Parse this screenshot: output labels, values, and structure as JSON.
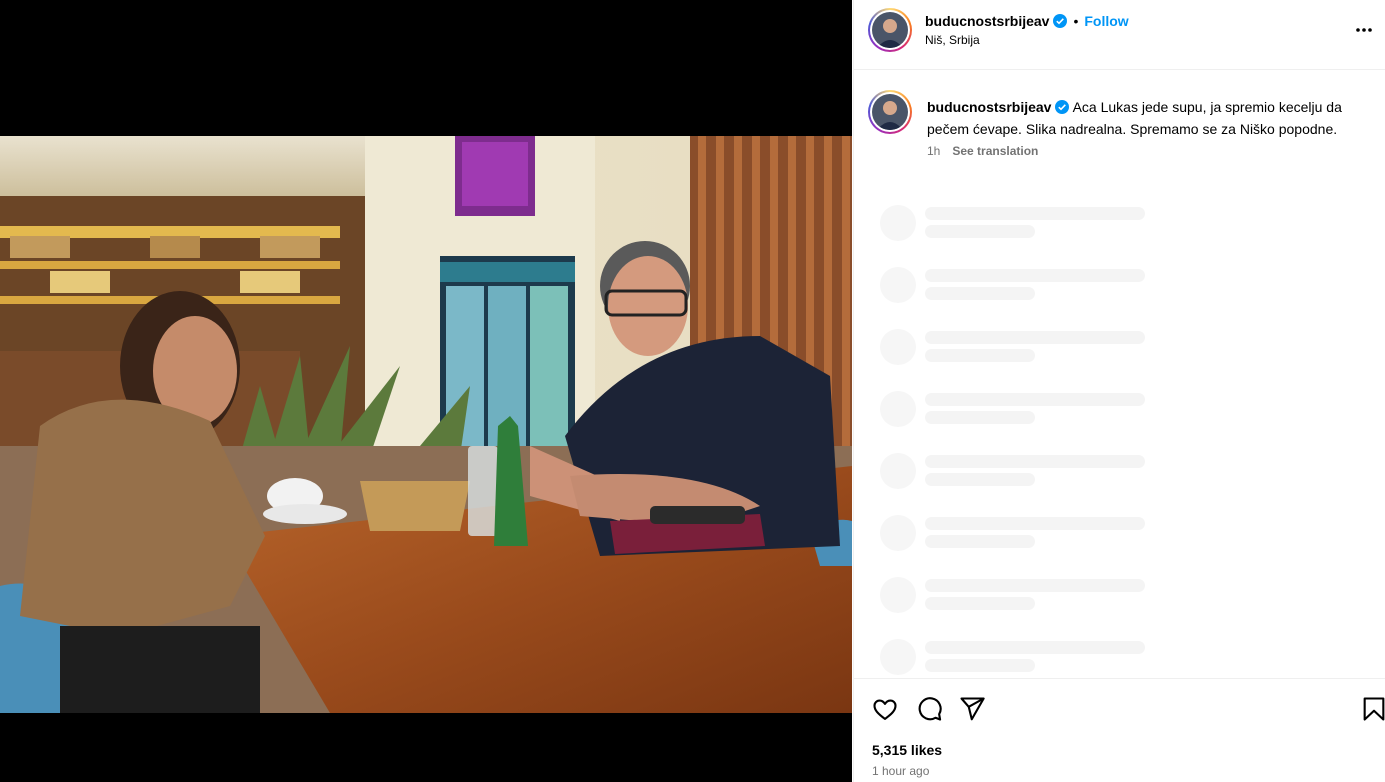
{
  "post": {
    "username": "buducnostsrbijeav",
    "follow_label": "Follow",
    "separator": "•",
    "location": "Niš, Srbija",
    "caption": "Aca Lukas jede supu, ja spremio kecelju da pečem ćevape. Slika nadrealna. Spremamo se za Niško popodne.",
    "caption_age": "1h",
    "see_translation": "See translation",
    "likes": "5,315 likes",
    "posted_time": "1 hour ago"
  },
  "icons": {
    "verified": "verified-badge-icon",
    "more": "more-options-icon",
    "like": "heart-icon",
    "comment": "comment-icon",
    "share": "share-icon",
    "save": "bookmark-icon"
  },
  "colors": {
    "accent": "#0095f6",
    "secondary_text": "#737373",
    "skeleton": "#f4f4f4"
  }
}
